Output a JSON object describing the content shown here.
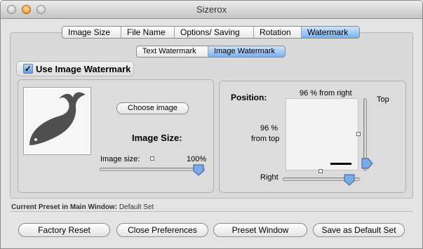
{
  "window": {
    "title": "Sizerox"
  },
  "main_tabs": [
    {
      "label": "Image Size",
      "active": false
    },
    {
      "label": "File Name",
      "active": false
    },
    {
      "label": "Options/ Saving",
      "active": false
    },
    {
      "label": "Rotation",
      "active": false
    },
    {
      "label": "Watermark",
      "active": true
    }
  ],
  "sub_tabs": [
    {
      "label": "Text Watermark",
      "active": false
    },
    {
      "label": "Image Watermark",
      "active": true
    }
  ],
  "use_image_watermark": {
    "label": "Use Image Watermark",
    "checked": true
  },
  "image_panel": {
    "image_icon": "whale-icon",
    "choose_image_label": "Choose image",
    "image_size_heading": "Image Size:",
    "image_size_label": "Image size:",
    "image_size_value": "100%",
    "image_size_level": 1.0
  },
  "position_panel": {
    "heading": "Position:",
    "from_right_text": "96 % from right",
    "from_top_value": "96 %",
    "from_top_text": "from top",
    "top_label": "Top",
    "right_label": "Right",
    "right_level": 0.96,
    "top_level": 0.96
  },
  "footer": {
    "preset_label": "Current Preset in Main Window:",
    "preset_value": "Default Set"
  },
  "buttons": {
    "factory_reset": "Factory Reset",
    "close_preferences": "Close Preferences",
    "preset_window": "Preset Window",
    "save_default": "Save as Default Set"
  }
}
